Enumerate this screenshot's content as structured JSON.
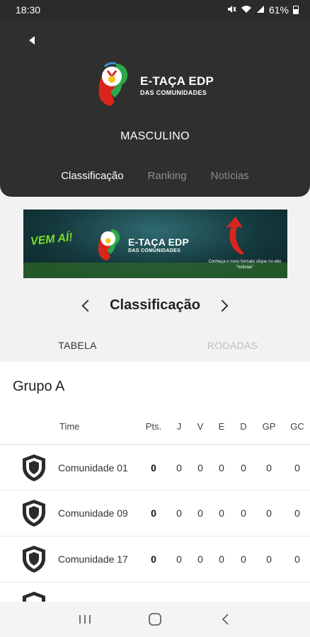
{
  "status_bar": {
    "time": "18:30",
    "battery": "61%"
  },
  "header": {
    "logo_title": "E-TAÇA EDP",
    "logo_subtitle": "DAS COMUNIDADES",
    "section_title": "MASCULINO",
    "tabs": [
      {
        "label": "Classificação",
        "active": true
      },
      {
        "label": "Ranking",
        "active": false
      },
      {
        "label": "Notícias",
        "active": false
      }
    ]
  },
  "banner": {
    "headline": "VEM AÍ!",
    "logo_title": "E-TAÇA EDP",
    "logo_subtitle": "DAS COMUNIDADES",
    "note": "Conheça o novo formato clique no ebo \"noticias\""
  },
  "classification": {
    "title": "Classificação",
    "subtabs": [
      {
        "label": "TABELA",
        "active": true
      },
      {
        "label": "RODADAS",
        "active": false
      }
    ]
  },
  "table": {
    "group": "Grupo A",
    "headers": [
      "Time",
      "Pts.",
      "J",
      "V",
      "E",
      "D",
      "GP",
      "GC"
    ],
    "rows": [
      {
        "team": "Comunidade 01",
        "values": [
          "0",
          "0",
          "0",
          "0",
          "0",
          "0",
          "0"
        ]
      },
      {
        "team": "Comunidade 09",
        "values": [
          "0",
          "0",
          "0",
          "0",
          "0",
          "0",
          "0"
        ]
      },
      {
        "team": "Comunidade 17",
        "values": [
          "0",
          "0",
          "0",
          "0",
          "0",
          "0",
          "0"
        ]
      }
    ]
  },
  "icons": {
    "back": "back-arrow-icon",
    "mute": "mute-icon",
    "wifi": "wifi-icon",
    "signal": "signal-icon",
    "battery": "battery-icon",
    "team": "shield-icon",
    "nav_recent": "recent-apps-icon",
    "nav_home": "home-icon",
    "nav_back": "nav-back-icon"
  },
  "colors": {
    "header_bg": "#2f2f2f",
    "accent_green": "#7bdc2b",
    "accent_red": "#d9251d"
  }
}
